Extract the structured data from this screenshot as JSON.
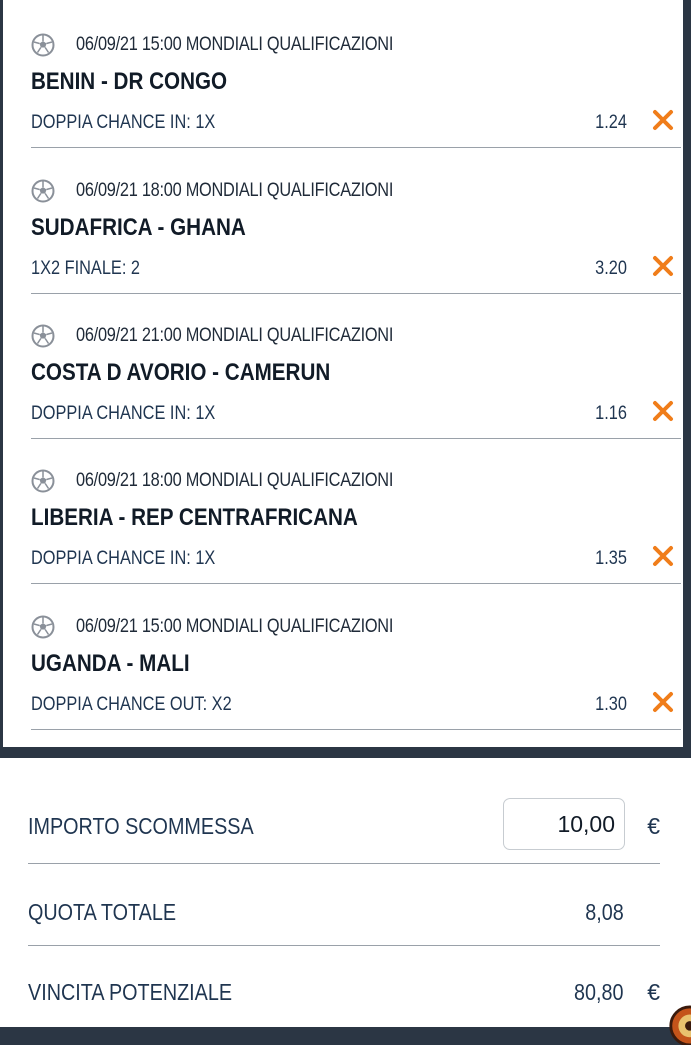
{
  "bets": [
    {
      "meta": "06/09/21 15:00 MONDIALI QUALIFICAZIONI",
      "match": "BENIN - DR CONGO",
      "pick": "DOPPIA CHANCE IN: 1X",
      "odd": "1.24"
    },
    {
      "meta": "06/09/21 18:00 MONDIALI QUALIFICAZIONI",
      "match": "SUDAFRICA - GHANA",
      "pick": "1X2 FINALE: 2",
      "odd": "3.20"
    },
    {
      "meta": "06/09/21 21:00 MONDIALI QUALIFICAZIONI",
      "match": "COSTA D AVORIO - CAMERUN",
      "pick": "DOPPIA CHANCE IN: 1X",
      "odd": "1.16"
    },
    {
      "meta": "06/09/21 18:00 MONDIALI QUALIFICAZIONI",
      "match": "LIBERIA - REP CENTRAFRICANA",
      "pick": "DOPPIA CHANCE IN: 1X",
      "odd": "1.35"
    },
    {
      "meta": "06/09/21 15:00 MONDIALI QUALIFICAZIONI",
      "match": "UGANDA - MALI",
      "pick": "DOPPIA CHANCE OUT: X2",
      "odd": "1.30"
    }
  ],
  "icons": {
    "sport": "soccer-ball-icon",
    "remove": "close-icon",
    "corner": "roulette-icon"
  },
  "colors": {
    "accent": "#f07d1a",
    "text": "#1f3550",
    "panel": "#2b3644"
  },
  "summary": {
    "stake_label": "IMPORTO SCOMMESSA",
    "stake_value": "10,00",
    "currency": "€",
    "total_odds_label": "QUOTA TOTALE",
    "total_odds_value": "8,08",
    "potential_win_label": "VINCITA POTENZIALE",
    "potential_win_value": "80,80"
  }
}
